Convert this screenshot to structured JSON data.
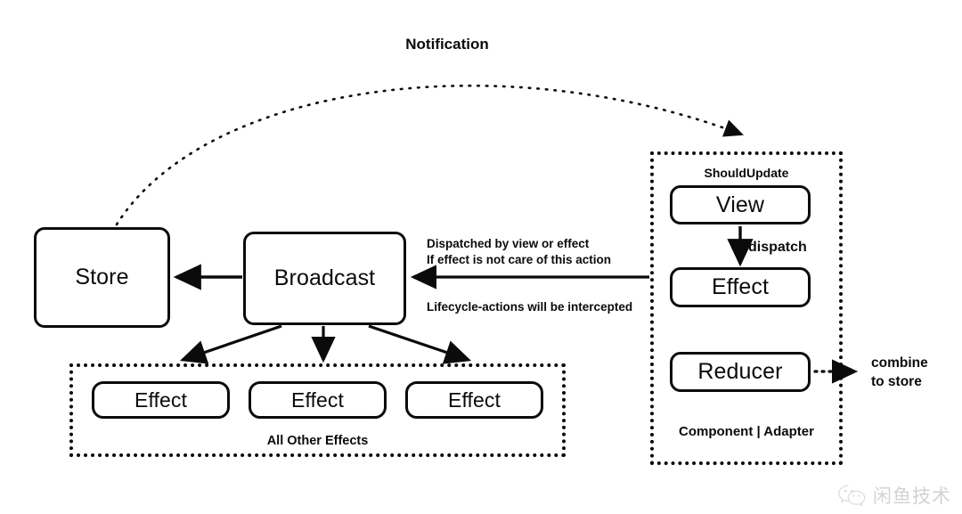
{
  "diagram": {
    "title_label": "Notification",
    "nodes": {
      "store": "Store",
      "broadcast": "Broadcast",
      "view": "View",
      "effect_right": "Effect",
      "reducer": "Reducer",
      "effect_1": "Effect",
      "effect_2": "Effect",
      "effect_3": "Effect"
    },
    "groups": {
      "all_other_effects": "All Other Effects",
      "component_adapter": "Component | Adapter"
    },
    "edge_labels": {
      "dispatched_line1": "Dispatched by view or effect",
      "dispatched_line2": "If effect is not care of this action",
      "lifecycle": "Lifecycle-actions will be intercepted",
      "should_update": "ShouldUpdate",
      "dispatch": "dispatch",
      "combine_line1": "combine",
      "combine_line2": "to store"
    },
    "colors": {
      "ink": "#0b0b0b",
      "background": "#ffffff",
      "watermark": "#6e6e6e"
    }
  },
  "watermark": {
    "text": "闲鱼技术",
    "icon": "wechat-icon"
  }
}
